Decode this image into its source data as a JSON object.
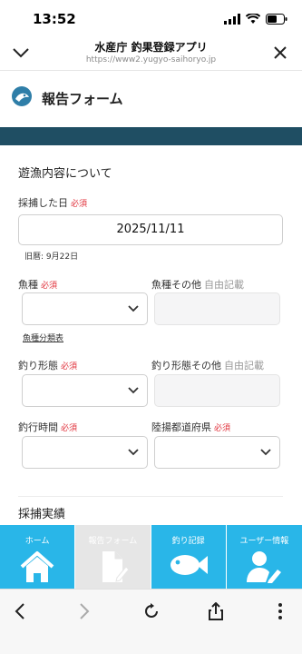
{
  "status": {
    "time": "13:52"
  },
  "browser": {
    "title": "水産庁 釣果登録アプリ",
    "url": "https://www2.yugyo-saihoryo.jp"
  },
  "app": {
    "title": "報告フォーム"
  },
  "form": {
    "section1_title": "遊漁内容について",
    "date_label": "採捕した日",
    "required": "必須",
    "date_value": "2025/11/11",
    "lunar_note": "旧暦: 9月22日",
    "fish_label": "魚種",
    "fish_other_label": "魚種その他",
    "free_text": "自由記載",
    "fish_category_link": "魚種分類表",
    "method_label": "釣り形態",
    "method_other_label": "釣り形態その他",
    "time_label": "釣行時間",
    "prefecture_label": "陸揚都道府県",
    "section2_title": "採捕実績"
  },
  "tabs": [
    {
      "label": "ホーム",
      "icon": "home-icon"
    },
    {
      "label": "報告フォーム",
      "icon": "form-edit-icon"
    },
    {
      "label": "釣り記録",
      "icon": "fish-icon"
    },
    {
      "label": "ユーザー情報",
      "icon": "user-edit-icon"
    }
  ],
  "colors": {
    "tab_bg": "#29b6e8",
    "tab_active_bg": "#e6e6e6",
    "band": "#1f4e63",
    "required": "#e0303a"
  }
}
